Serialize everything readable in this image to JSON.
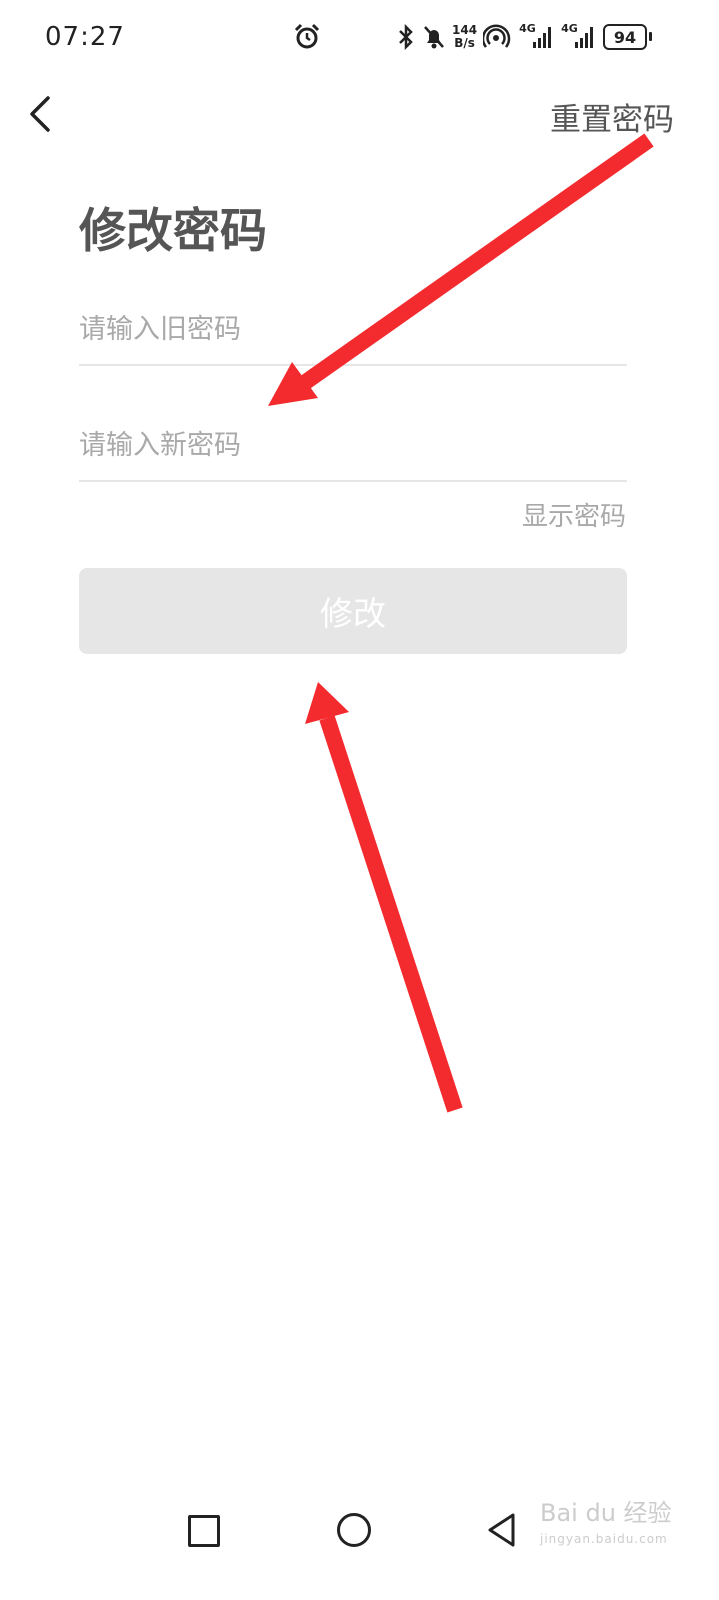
{
  "status_bar": {
    "time": "07:27",
    "net_speed_value": "144",
    "net_speed_unit": "B/s",
    "network_1": "4G",
    "network_2": "4G",
    "battery": "94"
  },
  "header": {
    "reset_label": "重置密码"
  },
  "page": {
    "title": "修改密码"
  },
  "form": {
    "old_placeholder": "请输入旧密码",
    "new_placeholder": "请输入新密码",
    "show_password": "显示密码",
    "submit_label": "修改"
  },
  "watermark": {
    "text": "Bai du 经验",
    "sub": "jingyan.baidu.com"
  },
  "colors": {
    "annotation_arrow": "#f32b2e",
    "button_disabled": "#e6e6e6",
    "placeholder": "#a9a9a9"
  }
}
